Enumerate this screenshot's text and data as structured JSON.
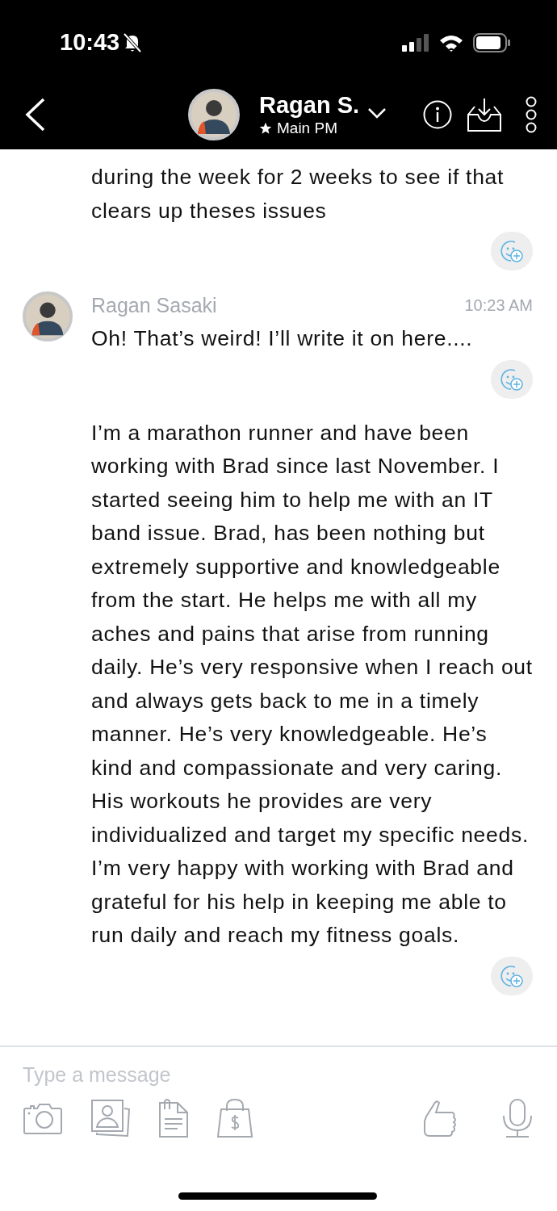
{
  "status_bar": {
    "time": "10:43"
  },
  "header": {
    "name": "Ragan S.",
    "subtitle": "Main PM"
  },
  "messages": [
    {
      "kind": "continuation",
      "text": "during the week for 2 weeks to see if that clears up theses issues"
    },
    {
      "kind": "with_header",
      "sender": "Ragan Sasaki",
      "time": "10:23 AM",
      "text": "Oh! That’s weird! I’ll write it on here...."
    },
    {
      "kind": "continuation",
      "text": "I’m a marathon runner and have been working with Brad since last November. I started seeing him to help me with an IT band issue. Brad, has been nothing but extremely supportive and knowledgeable from the start. He helps me with all my aches and pains that arise from running daily. He’s very responsive when I reach out and always gets back to me in a timely manner. He’s very knowledgeable. He’s kind and compassionate and very caring. His workouts he provides are very individualized and target my specific needs. I’m very happy with working with Brad and grateful for his help in keeping me able to run daily and reach my fitness goals."
    }
  ],
  "composer": {
    "placeholder": "Type a message"
  }
}
